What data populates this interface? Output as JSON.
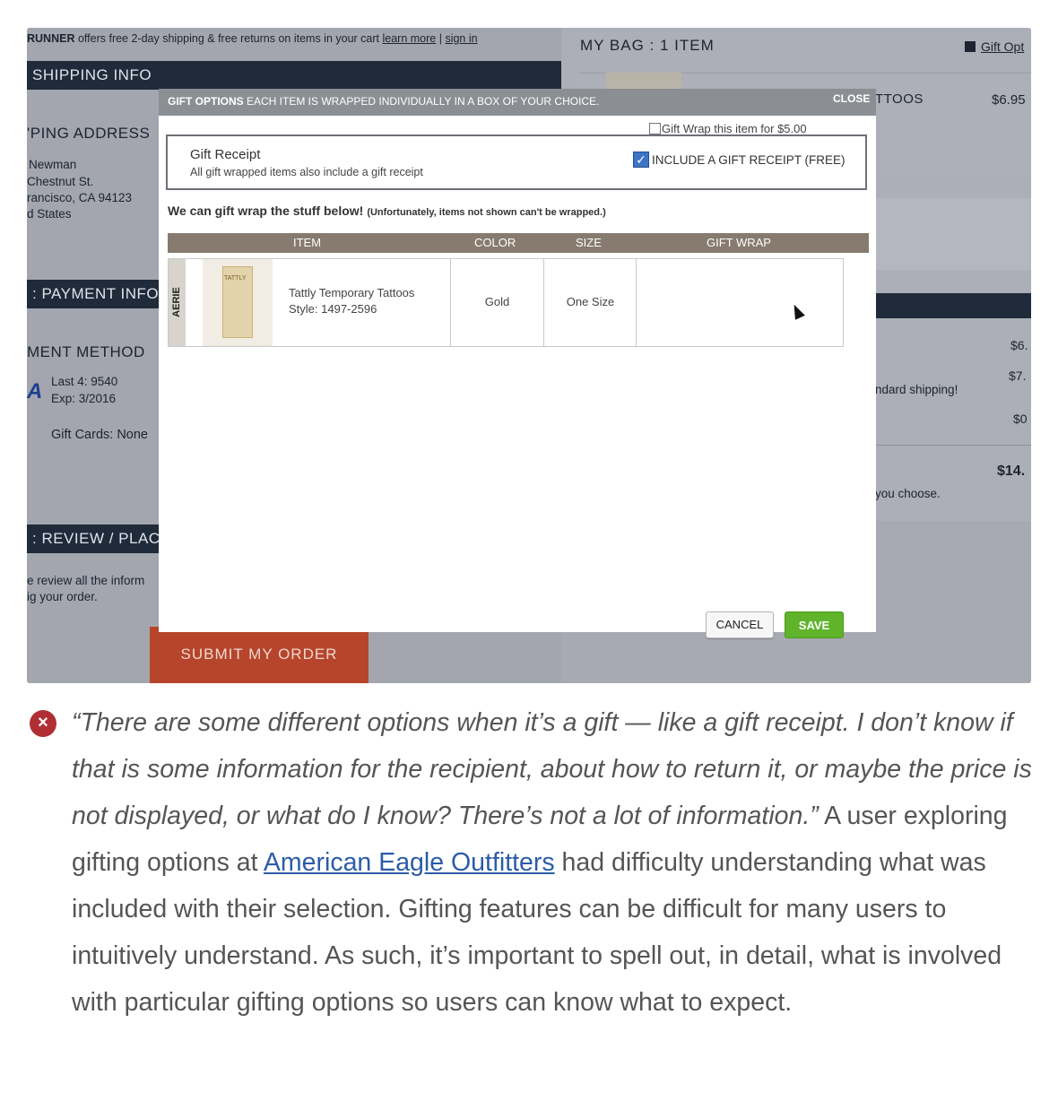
{
  "screenshot": {
    "promo": {
      "brand": "RUNNER",
      "text": " offers free 2-day shipping & free returns on items in your cart ",
      "learn_more": "learn more",
      "separator": " | ",
      "sign_in": "sign in"
    },
    "shipping_bar": "SHIPPING INFO",
    "shipping_address_heading": "'PING ADDRESS",
    "address_lines": [
      "Newman",
      "Chestnut St.",
      "rancisco, CA 94123",
      "d States"
    ],
    "payment_bar": ": PAYMENT INFO",
    "payment_method_heading": "MENT METHOD",
    "card_brand_fragment": "A",
    "card_last4": "Last 4: 9540",
    "card_exp": "Exp: 3/2016",
    "gift_cards": "Gift Cards: None",
    "review_bar": ": REVIEW / PLACE",
    "review_text_1": "e review all the inform",
    "review_text_2": "ig your order.",
    "submit_button": "SUBMIT MY ORDER",
    "bag_title": "MY BAG : 1 ITEM",
    "gift_options_link": "Gift Opt",
    "bag_item_name": "TTOOS",
    "bag_item_price": "$6.95",
    "summary_values": [
      "$6.",
      "$7.",
      "$0",
      "$14."
    ],
    "summary_note_shipping": "ndard shipping!",
    "summary_note_choose": "you choose."
  },
  "modal": {
    "header_bold": "GIFT OPTIONS",
    "header_text": " EACH ITEM IS WRAPPED INDIVIDUALLY IN A BOX OF YOUR CHOICE.",
    "close_label": "CLOSE",
    "receipt_title": "Gift Receipt",
    "receipt_subtitle": "All gift wrapped items also include a gift receipt",
    "receipt_checkbox_label": "INCLUDE A GIFT RECEIPT (FREE)",
    "receipt_checked": true,
    "wrap_intro": "We can gift wrap the stuff below!",
    "wrap_intro_note": "(Unfortunately, items not shown can't be wrapped.)",
    "columns": [
      "ITEM",
      "COLOR",
      "SIZE",
      "GIFT WRAP"
    ],
    "row": {
      "brand": "AERIE",
      "thumb_label": "TATTLY",
      "name": "Tattly Temporary Tattoos",
      "style": "Style: 1497-2596",
      "color": "Gold",
      "size": "One Size",
      "gift_wrap_label": "Gift Wrap this item for $5.00",
      "gift_wrap_checked": false
    },
    "cancel_label": "CANCEL",
    "save_label": "SAVE"
  },
  "caption": {
    "quote": "“There are some different options when it’s a gift — like a gift receipt. I don’t know if that is some information for the recipient, about how to return it, or maybe the price is not displayed, or what do I know? There’s not a lot of information.”",
    "lead": " A user exploring gifting options at ",
    "link_text": "American Eagle Outfitters",
    "rest": " had difficulty understanding what was included with their selection. Gifting features can be difficult for many users to intuitively understand. As such, it’s important to spell out, in detail, what is involved with particular gifting options so users can know what to expect."
  },
  "colors": {
    "navy_bar": "#1f2a3a",
    "submit_orange": "#b6452b",
    "save_green": "#5fb42a",
    "table_header": "#867b6e",
    "error_red": "#b12f34",
    "link_blue": "#2b5ca8"
  },
  "icons": [
    "error-x-icon",
    "checkbox-checked-icon",
    "checkbox-unchecked-icon",
    "gift-icon",
    "mouse-cursor-icon"
  ]
}
